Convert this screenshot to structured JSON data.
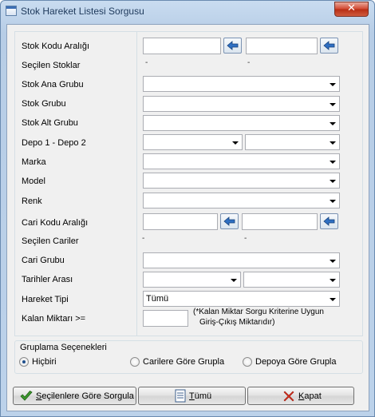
{
  "window": {
    "title": "Stok Hareket Listesi Sorgusu",
    "close_glyph": "✕"
  },
  "form": {
    "stok_kodu_label": "Stok Kodu Aralığı",
    "secilen_stoklar_label": "Seçilen Stoklar",
    "secilen_stoklar_value_1": "-",
    "secilen_stoklar_value_2": "-",
    "stok_ana_grubu_label": "Stok Ana Grubu",
    "stok_grubu_label": "Stok Grubu",
    "stok_alt_grubu_label": "Stok Alt Grubu",
    "depo_label": "Depo 1 - Depo 2",
    "marka_label": "Marka",
    "model_label": "Model",
    "renk_label": "Renk",
    "cari_kodu_label": "Cari Kodu Aralığı",
    "secilen_cariler_label": "Seçilen Cariler",
    "secilen_cariler_value_1": "-",
    "secilen_cariler_value_2": "-",
    "cari_grubu_label": "Cari Grubu",
    "tarihler_label": "Tarihler Arası",
    "hareket_tipi_label": "Hareket Tipi",
    "hareket_tipi_value": "Tümü",
    "kalan_miktar_label": "Kalan Miktarı >=",
    "kalan_miktar_note_1": "(*Kalan Miktar Sorgu Kriterine Uygun",
    "kalan_miktar_note_2": "Giriş-Çıkış Miktarıdır)"
  },
  "grouping": {
    "title": "Gruplama Seçenekleri",
    "options": [
      {
        "label": "Hiçbiri",
        "selected": true
      },
      {
        "label": "Carilere Göre Grupla",
        "selected": false
      },
      {
        "label": "Depoya Göre Grupla",
        "selected": false
      }
    ]
  },
  "buttons": {
    "query_first": "S",
    "query_rest": "eçilenlere Göre Sorgula",
    "all_first": "T",
    "all_rest": "ümü",
    "close_first": "K",
    "close_rest": "apat"
  },
  "icons": {
    "pick_button": "arrow-left-icon",
    "query": "check-icon",
    "all": "document-icon",
    "close": "red-x-icon"
  },
  "colors": {
    "close_button": "#c9452e",
    "accent_arrow": "#2f6fc2"
  }
}
